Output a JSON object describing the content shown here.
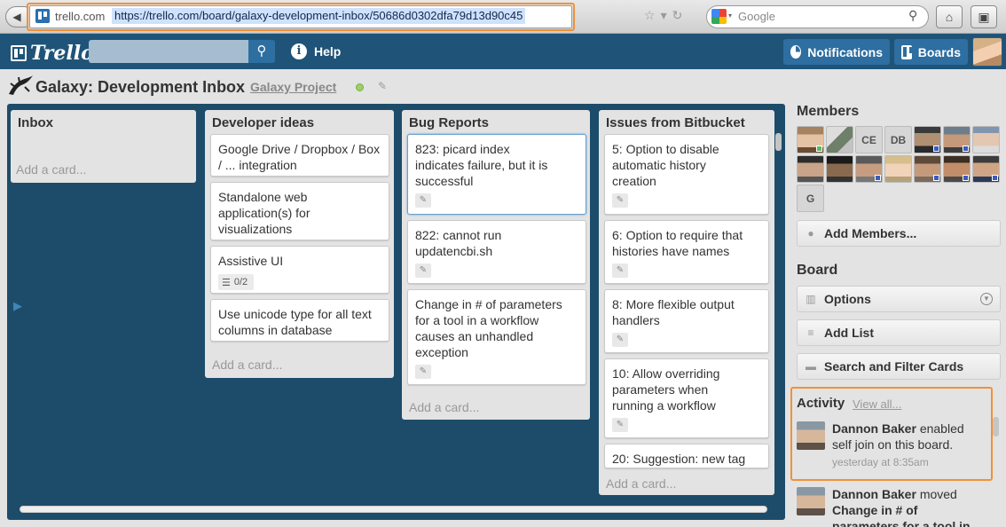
{
  "browser": {
    "domain": "trello.com",
    "url": "https://trello.com/board/galaxy-development-inbox/50686d0302dfa79d13d90c45",
    "search_placeholder": "Google"
  },
  "header": {
    "logo": "Trello",
    "help": "Help",
    "notifications": "Notifications",
    "boards": "Boards"
  },
  "board": {
    "title": "Galaxy: Development Inbox",
    "organization": "Galaxy Project"
  },
  "lists": [
    {
      "title": "Inbox",
      "cards": [],
      "add_card": "Add a card..."
    },
    {
      "title": "Developer ideas",
      "cards": [
        {
          "title": "Google Drive / Dropbox / Box / ... integration"
        },
        {
          "title": "Standalone web application(s) for visualizations"
        },
        {
          "title": "Assistive UI",
          "checklist": "0/2"
        },
        {
          "title": "Use unicode type for all text columns in database"
        }
      ],
      "add_card": "Add a card..."
    },
    {
      "title": "Bug Reports",
      "cards": [
        {
          "title": "823: picard index indicates failure, but it is successful"
        },
        {
          "title": "822: cannot run updatencbi.sh"
        },
        {
          "title": "Change in # of parameters for a tool in a workflow causes an unhandled exception"
        }
      ],
      "add_card": "Add a card..."
    },
    {
      "title": "Issues from Bitbucket",
      "cards": [
        {
          "title": "5: Option to disable automatic history creation"
        },
        {
          "title": "6: Option to require that histories have names"
        },
        {
          "title": "8: More flexible output handlers"
        },
        {
          "title": "10: Allow overriding parameters when running a workflow"
        },
        {
          "title": "20: Suggestion: new tag"
        }
      ],
      "add_card": "Add a card..."
    }
  ],
  "sidebar": {
    "members_title": "Members",
    "member_initials": [
      "CE",
      "DB",
      "G"
    ],
    "add_members": "Add Members...",
    "board_title": "Board",
    "options": "Options",
    "add_list": "Add List",
    "search_filter": "Search and Filter Cards"
  },
  "activity": {
    "title": "Activity",
    "view_all": "View all...",
    "items": [
      {
        "user": "Dannon Baker",
        "text": "enabled self join on this board.",
        "time": "yesterday at 8:35am"
      },
      {
        "user": "Dannon Baker",
        "text": "moved",
        "target": "Change in # of",
        "overflow": "parameters for a tool in"
      }
    ]
  }
}
